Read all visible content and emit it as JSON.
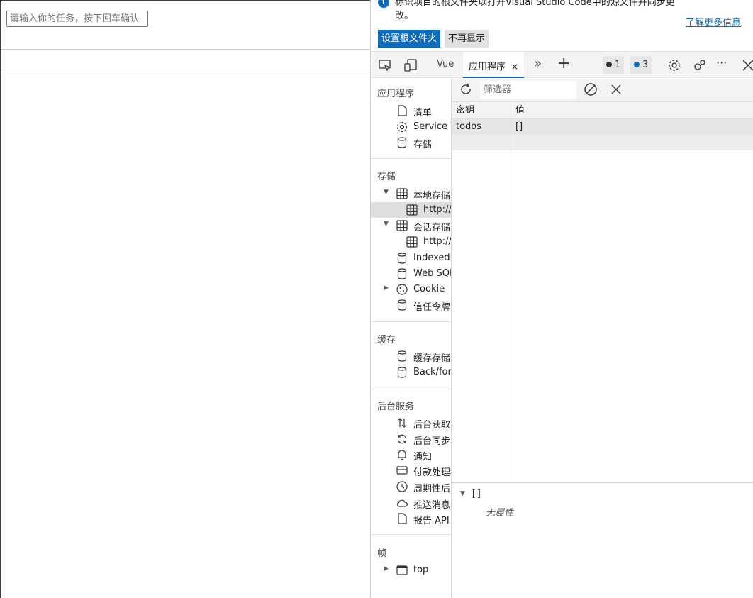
{
  "page": {
    "input_placeholder": "请输入你的任务，按下回车确认"
  },
  "infobar": {
    "message": "标识项目的根文件夹以打开Visual Studio Code中的源文件并同步更改。",
    "learn_more": "了解更多信息",
    "set_root_button": "设置根文件夹",
    "dismiss_button": "不再显示"
  },
  "toolbar": {
    "tabs": {
      "vue": "Vue",
      "application": "应用程序",
      "application_close": "×"
    },
    "more_tabs": "»",
    "add_tab": "+",
    "errors_count": "1",
    "messages_count": "3",
    "more": "···"
  },
  "sidebar": {
    "application_section": "应用程序",
    "manifest": "清单",
    "service_workers": "Service Workers",
    "storage_item": "存储",
    "storage_section": "存储",
    "local_storage": "本地存储",
    "local_storage_origin": "http://",
    "session_storage": "会话存储",
    "session_storage_origin": "http://",
    "indexeddb": "IndexedDB",
    "websql": "Web SQL",
    "cookies": "Cookie",
    "trust_tokens": "信任令牌",
    "cache_section": "缓存",
    "cache_storage": "缓存存储",
    "back_forward_cache": "Back/forward cache",
    "background_services_section": "后台服务",
    "background_fetch": "后台获取",
    "background_sync": "后台同步",
    "notifications": "通知",
    "payment_handler": "付款处理程序",
    "periodic_background_sync": "周期性后台同步",
    "push_messaging": "推送消息",
    "reporting_api": "报告 API",
    "frames_section": "帧",
    "top_frame": "top"
  },
  "storage": {
    "filter_placeholder": "筛选器",
    "columns": {
      "key": "密钥",
      "value": "值"
    },
    "rows": [
      {
        "key": "todos",
        "value": "[]"
      }
    ],
    "preview_value": "[]",
    "preview_empty": "无属性"
  },
  "colors": {
    "accent": "#0f6cbd",
    "selected_row": "#dedede"
  }
}
